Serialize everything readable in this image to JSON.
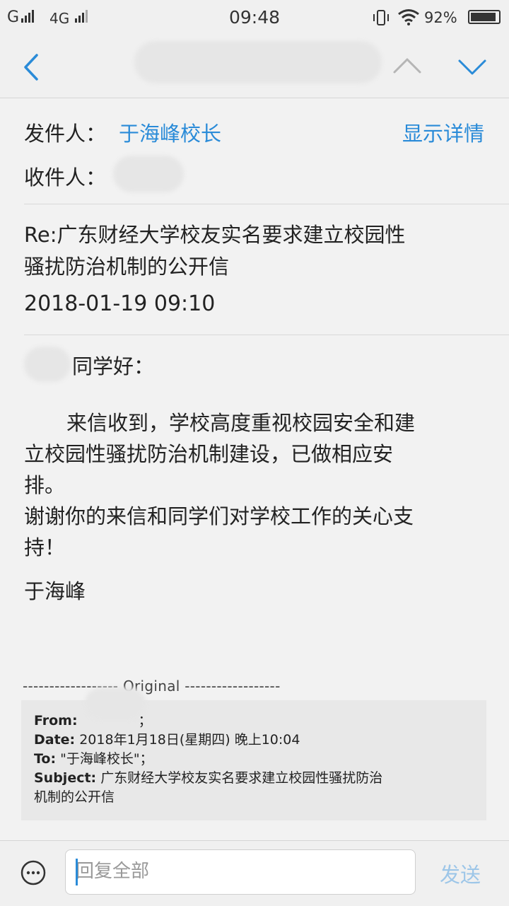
{
  "status_bar": {
    "carrier1": "G",
    "carrier2": "4G",
    "time": "09:48",
    "battery_percent": "92%",
    "battery_level": 0.92,
    "icons": [
      "signal-icon",
      "vibrate-icon",
      "wifi-icon",
      "battery-icon"
    ]
  },
  "nav": {
    "back_icon": "chevron-left-icon",
    "prev_icon": "chevron-up-icon",
    "next_icon": "chevron-down-icon"
  },
  "header": {
    "sender_label": "发件人：",
    "sender_name": "于海峰校长",
    "details_link": "显示详情",
    "recipient_label": "收件人："
  },
  "email": {
    "subject_line1": "Re:广东财经大学校友实名要求建立校园性",
    "subject_line2": "骚扰防治机制的公开信",
    "datetime": "2018-01-19  09:10",
    "greeting": "同学好：",
    "body_line1": "来信收到，学校高度重视校园安全和建",
    "body_line2": "立校园性骚扰防治机制建设，已做相应安",
    "body_line3": "排。",
    "body_line4": "谢谢你的来信和同学们对学校工作的关心支",
    "body_line5": "持！",
    "signature": "于海峰"
  },
  "original": {
    "separator": "------------------ Original ------------------",
    "from_label": "From:",
    "from_value": " ；",
    "date_label": "Date:",
    "date_value": " 2018年1月18日(星期四) 晚上10:04",
    "to_label": "To:",
    "to_value": " \"于海峰校长\"；",
    "subject_label": "Subject:",
    "subject_value": " 广东财经大学校友实名要求建立校园性骚扰防治",
    "subject_value2": "机制的公开信"
  },
  "composer": {
    "emoji_icon": "smiley-icon",
    "placeholder": "回复全部",
    "send_label": "发送"
  },
  "colors": {
    "accent": "#2a8bd8",
    "send_disabled": "#9dc6e8",
    "background": "#f2f2f2"
  }
}
